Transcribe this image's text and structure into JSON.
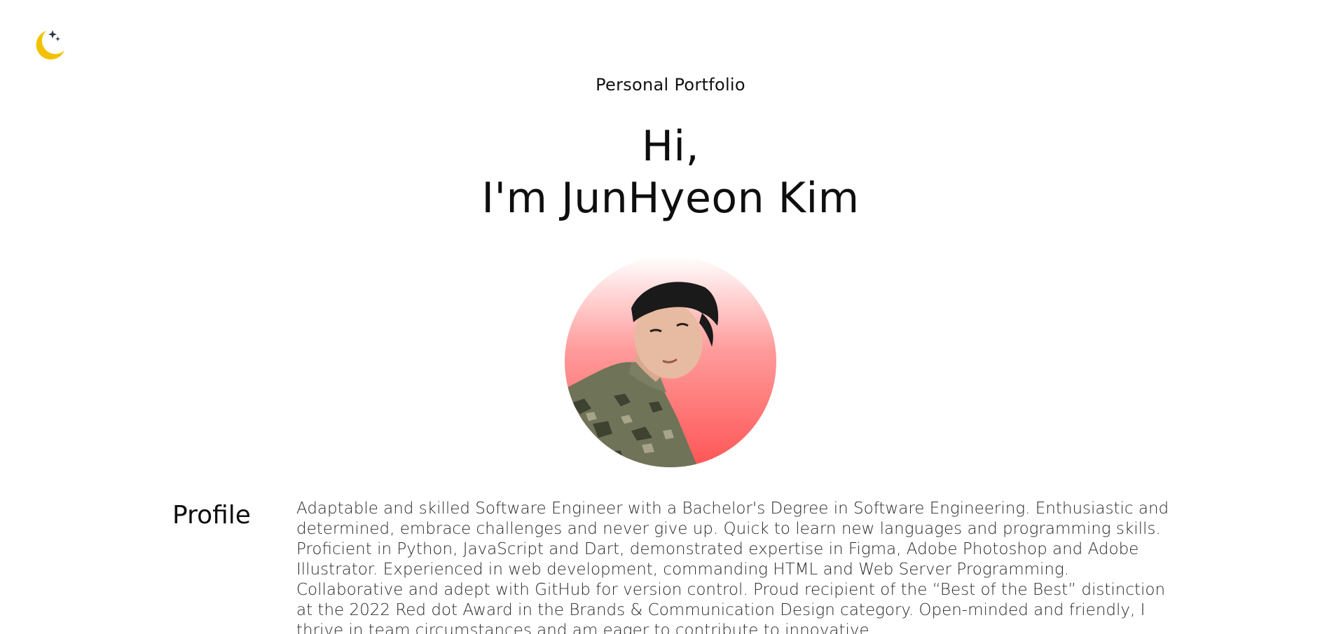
{
  "header": {
    "theme_toggle_icon": "moon-stars-icon",
    "theme_toggle_color": "#F2C200"
  },
  "hero": {
    "eyebrow": "Personal Portfolio",
    "greeting": "Hi,",
    "name_line": "I'm JunHyeon Kim"
  },
  "avatar": {
    "gradient_top": "#FFFFFF",
    "gradient_bottom": "#FF5555"
  },
  "profile": {
    "heading": "Profile",
    "text": "Adaptable and skilled Software Engineer with a Bachelor's Degree in Software Engineering. Enthusiastic and determined, embrace challenges and never give up. Quick to learn new languages and programming skills. Proficient in Python, JavaScript and Dart, demonstrated expertise in Figma, Adobe Photoshop and Adobe Illustrator. Experienced in web development, commanding HTML and Web Server Programming. Collaborative and adept with GitHub for version control. Proud recipient of the “Best of the Best” distinction at the 2022 Red dot Award in the Brands & Communication Design category. Open-minded and friendly, I thrive in team circumstances and am eager to contribute to innovative"
  }
}
